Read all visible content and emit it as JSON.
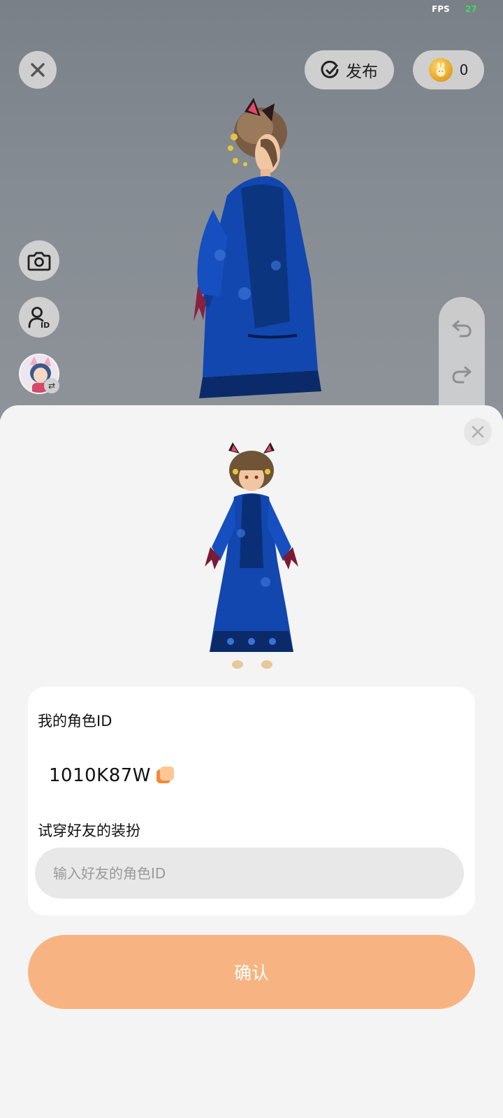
{
  "status": {
    "fps_label": "FPS",
    "fps_value": "27"
  },
  "toolbar": {
    "publish_label": "发布",
    "coin_count": "0",
    "coin_glyph": "🐰"
  },
  "sidebar": {
    "buttons": [
      {
        "icon": "camera-icon"
      },
      {
        "icon": "user-id-icon"
      },
      {
        "icon": "avatar-switch-icon"
      }
    ]
  },
  "history": {
    "undo_icon": "undo-icon",
    "redo_icon": "redo-icon"
  },
  "sheet": {
    "my_id_label": "我的角色ID",
    "my_id_value": "1010K87W",
    "tryon_label": "试穿好友的装扮",
    "friend_id_placeholder": "输入好友的角色ID",
    "friend_id_value": "",
    "confirm_label": "确认"
  },
  "colors": {
    "accent": "#f7b482",
    "copy_accent": "#f08a3c",
    "robe_blue": "#0f3f9e",
    "fps_green": "#3ddc5a"
  }
}
